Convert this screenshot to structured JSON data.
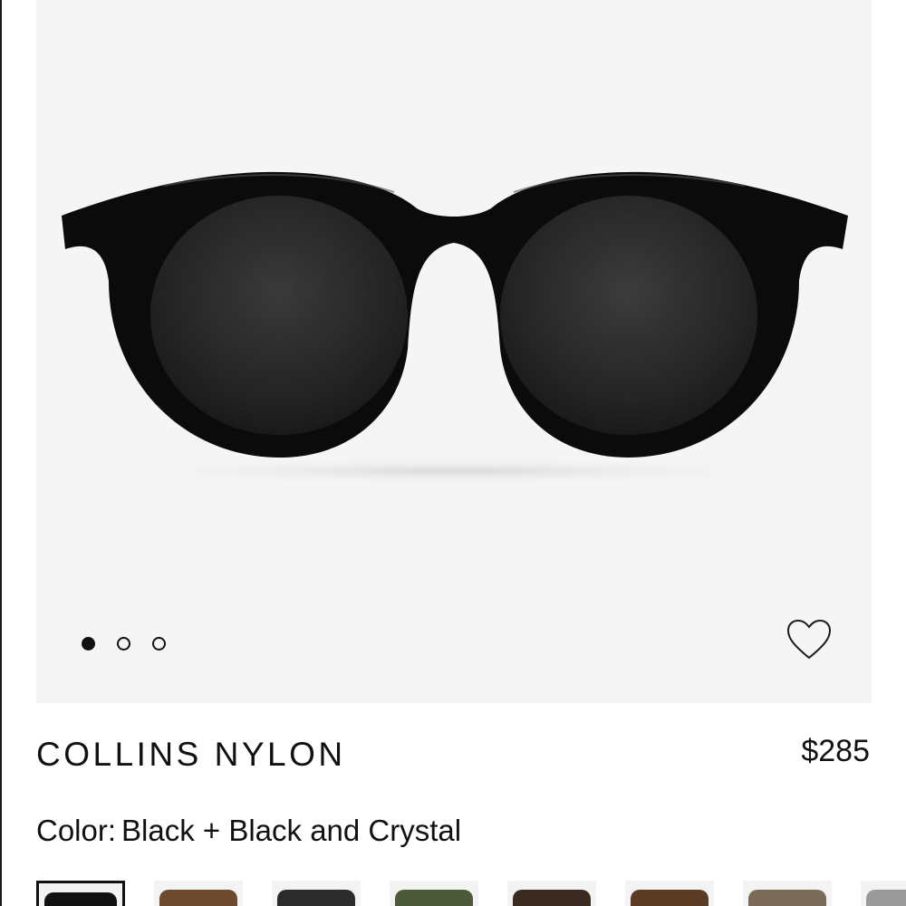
{
  "product": {
    "name": "COLLINS NYLON",
    "price": "$285",
    "color_label": "Color:",
    "color_value": "Black + Black and Crystal"
  },
  "gallery": {
    "image_count": 3,
    "active_index": 0,
    "background_color": "#f5f5f5",
    "icons": {
      "wishlist": "heart-outline-icon"
    }
  },
  "swatches": [
    {
      "frame_color": "#111111",
      "selected": true
    },
    {
      "frame_color": "#6b4a2e",
      "selected": false
    },
    {
      "frame_color": "#2b2b2b",
      "selected": false
    },
    {
      "frame_color": "#4d5a3a",
      "selected": false
    },
    {
      "frame_color": "#3a2a20",
      "selected": false
    },
    {
      "frame_color": "#5c3b24",
      "selected": false
    },
    {
      "frame_color": "#7a6a58",
      "selected": false
    },
    {
      "frame_color": "#9a9a9a",
      "selected": false
    }
  ]
}
